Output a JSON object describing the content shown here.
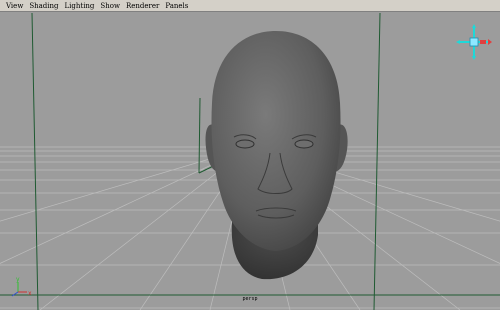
{
  "menu": {
    "items": [
      {
        "label": "View"
      },
      {
        "label": "Shading"
      },
      {
        "label": "Lighting"
      },
      {
        "label": "Show"
      },
      {
        "label": "Renderer"
      },
      {
        "label": "Panels"
      }
    ]
  },
  "viewport": {
    "camera_name": "persp",
    "background_color": "#9c9c9c",
    "grid_color": "#c0c0c0",
    "axis_line_color": "#1f5a32",
    "model_color": "#5e5e5e"
  },
  "icons": {
    "view_cube": "view-cube-icon",
    "axis_gizmo": "axis-indicator-icon"
  }
}
